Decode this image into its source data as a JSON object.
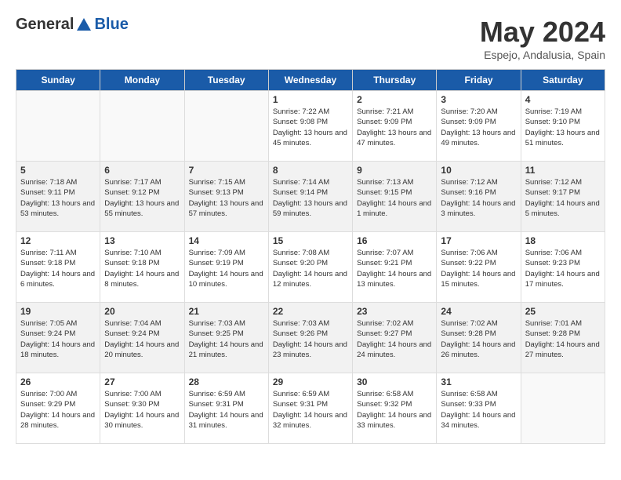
{
  "header": {
    "logo_general": "General",
    "logo_blue": "Blue",
    "month": "May 2024",
    "location": "Espejo, Andalusia, Spain"
  },
  "weekdays": [
    "Sunday",
    "Monday",
    "Tuesday",
    "Wednesday",
    "Thursday",
    "Friday",
    "Saturday"
  ],
  "weeks": [
    {
      "shaded": false,
      "days": [
        {
          "num": "",
          "sunrise": "",
          "sunset": "",
          "daylight": "",
          "empty": true
        },
        {
          "num": "",
          "sunrise": "",
          "sunset": "",
          "daylight": "",
          "empty": true
        },
        {
          "num": "",
          "sunrise": "",
          "sunset": "",
          "daylight": "",
          "empty": true
        },
        {
          "num": "1",
          "sunrise": "Sunrise: 7:22 AM",
          "sunset": "Sunset: 9:08 PM",
          "daylight": "Daylight: 13 hours and 45 minutes."
        },
        {
          "num": "2",
          "sunrise": "Sunrise: 7:21 AM",
          "sunset": "Sunset: 9:09 PM",
          "daylight": "Daylight: 13 hours and 47 minutes."
        },
        {
          "num": "3",
          "sunrise": "Sunrise: 7:20 AM",
          "sunset": "Sunset: 9:09 PM",
          "daylight": "Daylight: 13 hours and 49 minutes."
        },
        {
          "num": "4",
          "sunrise": "Sunrise: 7:19 AM",
          "sunset": "Sunset: 9:10 PM",
          "daylight": "Daylight: 13 hours and 51 minutes."
        }
      ]
    },
    {
      "shaded": true,
      "days": [
        {
          "num": "5",
          "sunrise": "Sunrise: 7:18 AM",
          "sunset": "Sunset: 9:11 PM",
          "daylight": "Daylight: 13 hours and 53 minutes."
        },
        {
          "num": "6",
          "sunrise": "Sunrise: 7:17 AM",
          "sunset": "Sunset: 9:12 PM",
          "daylight": "Daylight: 13 hours and 55 minutes."
        },
        {
          "num": "7",
          "sunrise": "Sunrise: 7:15 AM",
          "sunset": "Sunset: 9:13 PM",
          "daylight": "Daylight: 13 hours and 57 minutes."
        },
        {
          "num": "8",
          "sunrise": "Sunrise: 7:14 AM",
          "sunset": "Sunset: 9:14 PM",
          "daylight": "Daylight: 13 hours and 59 minutes."
        },
        {
          "num": "9",
          "sunrise": "Sunrise: 7:13 AM",
          "sunset": "Sunset: 9:15 PM",
          "daylight": "Daylight: 14 hours and 1 minute."
        },
        {
          "num": "10",
          "sunrise": "Sunrise: 7:12 AM",
          "sunset": "Sunset: 9:16 PM",
          "daylight": "Daylight: 14 hours and 3 minutes."
        },
        {
          "num": "11",
          "sunrise": "Sunrise: 7:12 AM",
          "sunset": "Sunset: 9:17 PM",
          "daylight": "Daylight: 14 hours and 5 minutes."
        }
      ]
    },
    {
      "shaded": false,
      "days": [
        {
          "num": "12",
          "sunrise": "Sunrise: 7:11 AM",
          "sunset": "Sunset: 9:18 PM",
          "daylight": "Daylight: 14 hours and 6 minutes."
        },
        {
          "num": "13",
          "sunrise": "Sunrise: 7:10 AM",
          "sunset": "Sunset: 9:18 PM",
          "daylight": "Daylight: 14 hours and 8 minutes."
        },
        {
          "num": "14",
          "sunrise": "Sunrise: 7:09 AM",
          "sunset": "Sunset: 9:19 PM",
          "daylight": "Daylight: 14 hours and 10 minutes."
        },
        {
          "num": "15",
          "sunrise": "Sunrise: 7:08 AM",
          "sunset": "Sunset: 9:20 PM",
          "daylight": "Daylight: 14 hours and 12 minutes."
        },
        {
          "num": "16",
          "sunrise": "Sunrise: 7:07 AM",
          "sunset": "Sunset: 9:21 PM",
          "daylight": "Daylight: 14 hours and 13 minutes."
        },
        {
          "num": "17",
          "sunrise": "Sunrise: 7:06 AM",
          "sunset": "Sunset: 9:22 PM",
          "daylight": "Daylight: 14 hours and 15 minutes."
        },
        {
          "num": "18",
          "sunrise": "Sunrise: 7:06 AM",
          "sunset": "Sunset: 9:23 PM",
          "daylight": "Daylight: 14 hours and 17 minutes."
        }
      ]
    },
    {
      "shaded": true,
      "days": [
        {
          "num": "19",
          "sunrise": "Sunrise: 7:05 AM",
          "sunset": "Sunset: 9:24 PM",
          "daylight": "Daylight: 14 hours and 18 minutes."
        },
        {
          "num": "20",
          "sunrise": "Sunrise: 7:04 AM",
          "sunset": "Sunset: 9:24 PM",
          "daylight": "Daylight: 14 hours and 20 minutes."
        },
        {
          "num": "21",
          "sunrise": "Sunrise: 7:03 AM",
          "sunset": "Sunset: 9:25 PM",
          "daylight": "Daylight: 14 hours and 21 minutes."
        },
        {
          "num": "22",
          "sunrise": "Sunrise: 7:03 AM",
          "sunset": "Sunset: 9:26 PM",
          "daylight": "Daylight: 14 hours and 23 minutes."
        },
        {
          "num": "23",
          "sunrise": "Sunrise: 7:02 AM",
          "sunset": "Sunset: 9:27 PM",
          "daylight": "Daylight: 14 hours and 24 minutes."
        },
        {
          "num": "24",
          "sunrise": "Sunrise: 7:02 AM",
          "sunset": "Sunset: 9:28 PM",
          "daylight": "Daylight: 14 hours and 26 minutes."
        },
        {
          "num": "25",
          "sunrise": "Sunrise: 7:01 AM",
          "sunset": "Sunset: 9:28 PM",
          "daylight": "Daylight: 14 hours and 27 minutes."
        }
      ]
    },
    {
      "shaded": false,
      "days": [
        {
          "num": "26",
          "sunrise": "Sunrise: 7:00 AM",
          "sunset": "Sunset: 9:29 PM",
          "daylight": "Daylight: 14 hours and 28 minutes."
        },
        {
          "num": "27",
          "sunrise": "Sunrise: 7:00 AM",
          "sunset": "Sunset: 9:30 PM",
          "daylight": "Daylight: 14 hours and 30 minutes."
        },
        {
          "num": "28",
          "sunrise": "Sunrise: 6:59 AM",
          "sunset": "Sunset: 9:31 PM",
          "daylight": "Daylight: 14 hours and 31 minutes."
        },
        {
          "num": "29",
          "sunrise": "Sunrise: 6:59 AM",
          "sunset": "Sunset: 9:31 PM",
          "daylight": "Daylight: 14 hours and 32 minutes."
        },
        {
          "num": "30",
          "sunrise": "Sunrise: 6:58 AM",
          "sunset": "Sunset: 9:32 PM",
          "daylight": "Daylight: 14 hours and 33 minutes."
        },
        {
          "num": "31",
          "sunrise": "Sunrise: 6:58 AM",
          "sunset": "Sunset: 9:33 PM",
          "daylight": "Daylight: 14 hours and 34 minutes."
        },
        {
          "num": "",
          "sunrise": "",
          "sunset": "",
          "daylight": "",
          "empty": true
        }
      ]
    }
  ]
}
